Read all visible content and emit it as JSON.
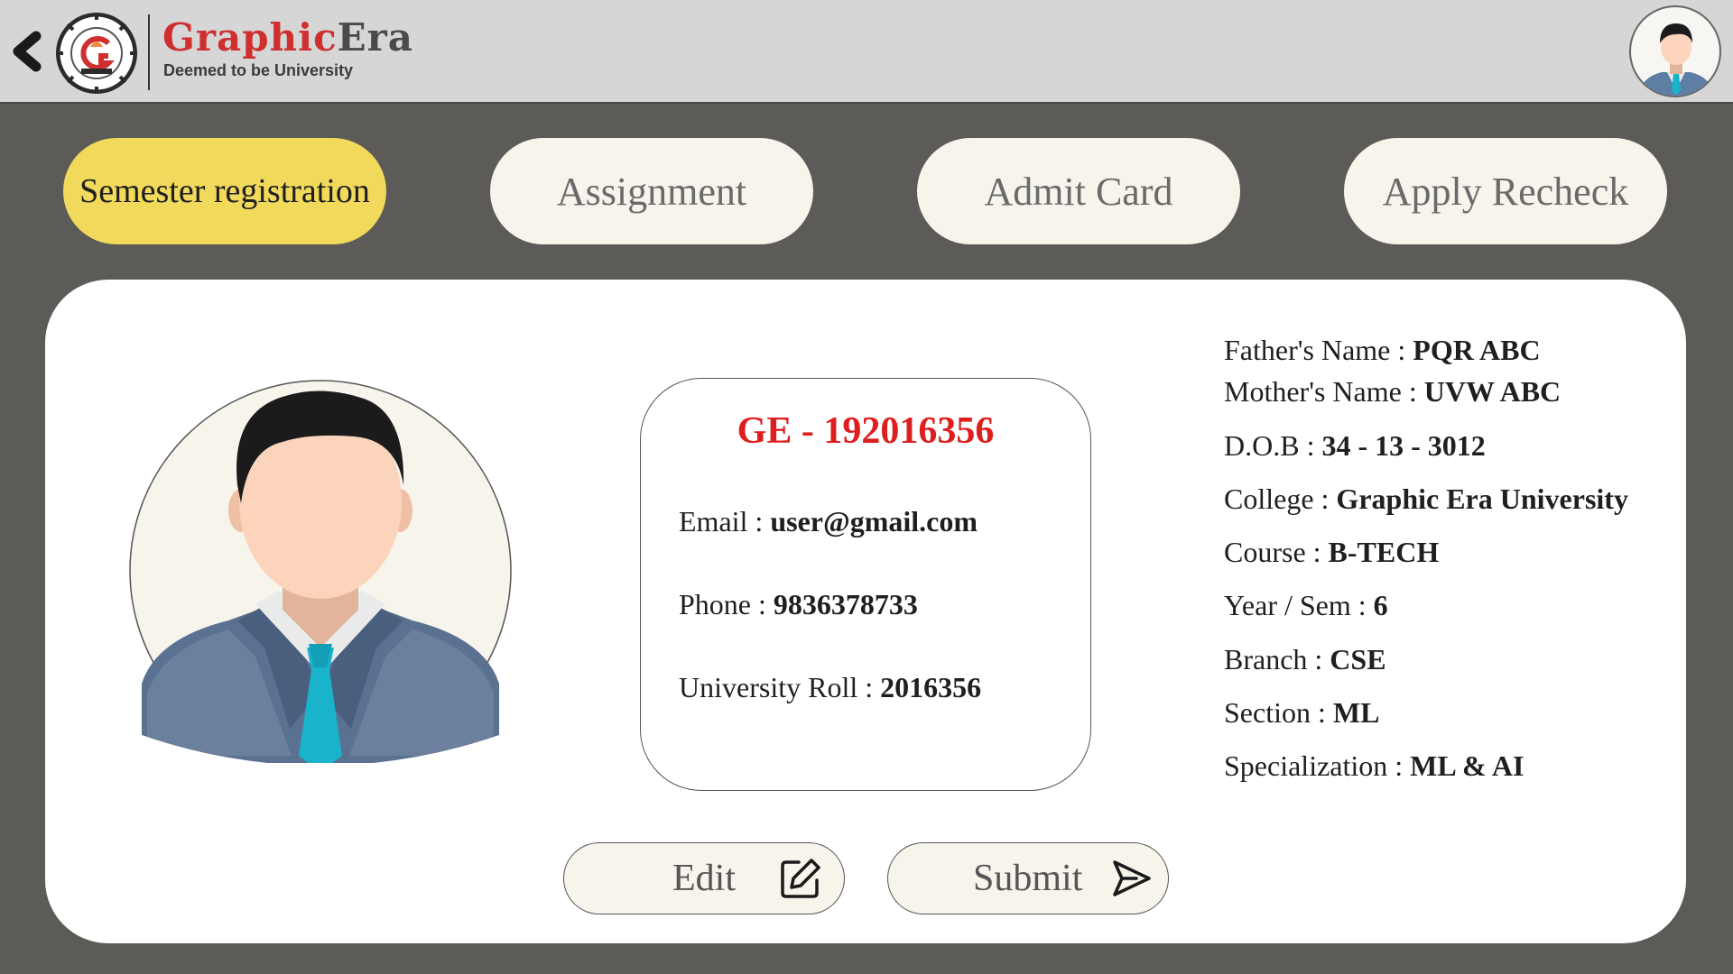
{
  "header": {
    "brand_part1": "Graphic",
    "brand_part2": "Era",
    "tagline": "Deemed to be University",
    "back_icon": "chevron-left-icon",
    "profile_icon": "user-avatar-icon"
  },
  "tabs": [
    {
      "label": "Semester registration",
      "active": true
    },
    {
      "label": "Assignment",
      "active": false
    },
    {
      "label": "Admit Card",
      "active": false
    },
    {
      "label": "Apply Recheck",
      "active": false
    }
  ],
  "id_card": {
    "id_number": "GE - 192016356",
    "email_label": "Email : ",
    "email_value": "user@gmail.com",
    "phone_label": "Phone : ",
    "phone_value": "9836378733",
    "roll_label": "University Roll : ",
    "roll_value": "2016356"
  },
  "details": [
    {
      "label": "Father's Name : ",
      "value": "PQR ABC"
    },
    {
      "label": "Mother's Name : ",
      "value": "UVW ABC"
    },
    {
      "label": "D.O.B : ",
      "value": "34 - 13 - 3012"
    },
    {
      "label": "College : ",
      "value": "Graphic Era University"
    },
    {
      "label": "Course : ",
      "value": "B-TECH"
    },
    {
      "label": "Year / Sem : ",
      "value": "6"
    },
    {
      "label": "Branch : ",
      "value": "CSE"
    },
    {
      "label": "Section : ",
      "value": "ML"
    },
    {
      "label": "Specialization : ",
      "value": "ML & AI"
    }
  ],
  "actions": {
    "edit_label": "Edit",
    "edit_icon": "edit-pencil-icon",
    "submit_label": "Submit",
    "submit_icon": "send-arrow-icon"
  },
  "colors": {
    "background": "#5c5b58",
    "header": "#d6d6d6",
    "active_tab": "#f1d95c",
    "tab": "#f7f4ec",
    "id_number": "#dd1f1f",
    "brand_red": "#cf2f2f"
  }
}
